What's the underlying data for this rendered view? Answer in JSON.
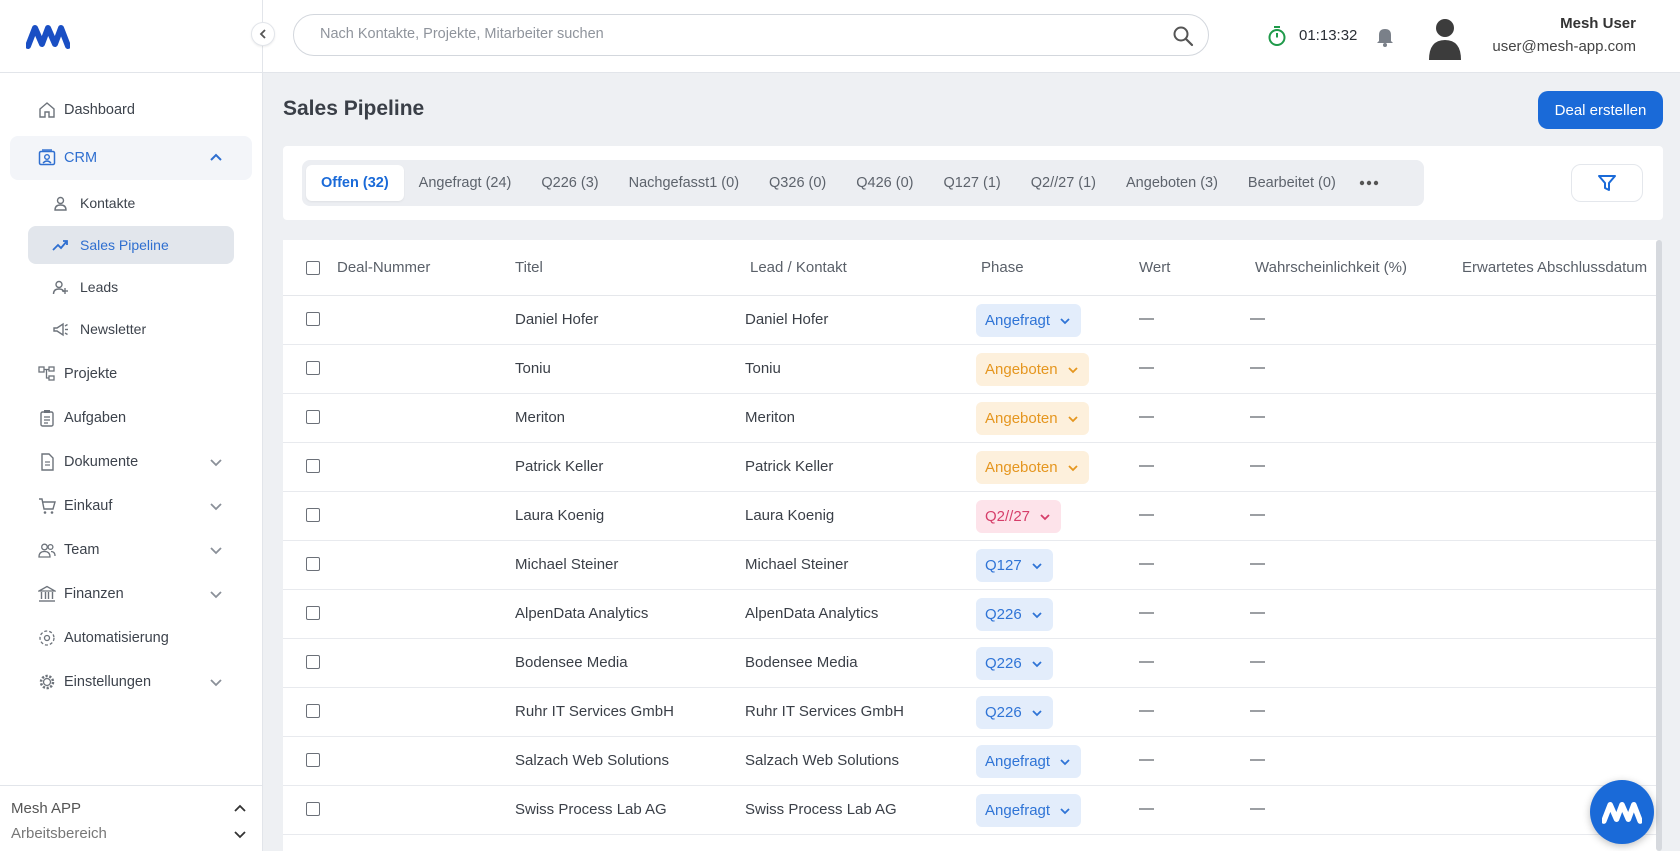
{
  "sidebar": {
    "nav": {
      "dashboard": "Dashboard",
      "crm": "CRM",
      "kontakte": "Kontakte",
      "sales_pipeline": "Sales Pipeline",
      "leads": "Leads",
      "newsletter": "Newsletter",
      "projekte": "Projekte",
      "aufgaben": "Aufgaben",
      "dokumente": "Dokumente",
      "einkauf": "Einkauf",
      "team": "Team",
      "finanzen": "Finanzen",
      "automatisierung": "Automatisierung",
      "einstellungen": "Einstellungen"
    },
    "footer": {
      "app_name": "Mesh APP",
      "workspace": "Arbeitsbereich"
    }
  },
  "header": {
    "search_placeholder": "Nach Kontakte, Projekte, Mitarbeiter suchen",
    "timer": "01:13:32",
    "user_name": "Mesh User",
    "user_email": "user@mesh-app.com"
  },
  "main": {
    "title": "Sales Pipeline",
    "create_button": "Deal erstellen",
    "tabs": [
      {
        "label": "Offen (32)",
        "active": true
      },
      {
        "label": "Angefragt (24)"
      },
      {
        "label": "Q226 (3)"
      },
      {
        "label": "Nachgefasst1 (0)"
      },
      {
        "label": "Q326 (0)"
      },
      {
        "label": "Q426 (0)"
      },
      {
        "label": "Q127 (1)"
      },
      {
        "label": "Q2//27 (1)"
      },
      {
        "label": "Angeboten (3)"
      },
      {
        "label": "Bearbeitet (0)"
      }
    ],
    "table": {
      "columns": [
        "Deal-Nummer",
        "Titel",
        "Lead / Kontakt",
        "Phase",
        "Wert",
        "Wahrscheinlichkeit (%)",
        "Erwartetes Abschlussdatum"
      ],
      "rows": [
        {
          "deal_number": "",
          "title": "Daniel Hofer",
          "contact": "Daniel Hofer",
          "phase": "Angefragt",
          "value": "—",
          "probability": "—"
        },
        {
          "deal_number": "",
          "title": "Toniu",
          "contact": "Toniu",
          "phase": "Angeboten",
          "value": "—",
          "probability": "—"
        },
        {
          "deal_number": "",
          "title": "Meriton",
          "contact": "Meriton",
          "phase": "Angeboten",
          "value": "—",
          "probability": "—"
        },
        {
          "deal_number": "",
          "title": "Patrick Keller",
          "contact": "Patrick Keller",
          "phase": "Angeboten",
          "value": "—",
          "probability": "—"
        },
        {
          "deal_number": "",
          "title": "Laura Koenig",
          "contact": "Laura Koenig",
          "phase": "Q2//27",
          "value": "—",
          "probability": "—"
        },
        {
          "deal_number": "",
          "title": "Michael Steiner",
          "contact": "Michael Steiner",
          "phase": "Q127",
          "value": "—",
          "probability": "—"
        },
        {
          "deal_number": "",
          "title": "AlpenData Analytics",
          "contact": "AlpenData Analytics",
          "phase": "Q226",
          "value": "—",
          "probability": "—"
        },
        {
          "deal_number": "",
          "title": "Bodensee Media",
          "contact": "Bodensee Media",
          "phase": "Q226",
          "value": "—",
          "probability": "—"
        },
        {
          "deal_number": "",
          "title": "Ruhr IT Services GmbH",
          "contact": "Ruhr IT Services GmbH",
          "phase": "Q226",
          "value": "—",
          "probability": "—"
        },
        {
          "deal_number": "",
          "title": "Salzach Web Solutions",
          "contact": "Salzach Web Solutions",
          "phase": "Angefragt",
          "value": "—",
          "probability": "—"
        },
        {
          "deal_number": "",
          "title": "Swiss Process Lab AG",
          "contact": "Swiss Process Lab AG",
          "phase": "Angefragt",
          "value": "—",
          "probability": "—"
        }
      ]
    }
  },
  "colors": {
    "accent": "#1a6ad8",
    "phase_blue_bg": "#e3edfb",
    "phase_blue_fg": "#2f74d6",
    "phase_orange_bg": "#fdf0dc",
    "phase_orange_fg": "#e5961f",
    "phase_pink_bg": "#fde3ea",
    "phase_pink_fg": "#d63e6a"
  },
  "icons": {
    "logo": "mesh-logo",
    "search": "search-icon",
    "timer": "stopwatch-icon",
    "bell": "bell-icon",
    "avatar": "user-avatar",
    "filter": "filter-icon",
    "more": "more-dots-icon"
  }
}
